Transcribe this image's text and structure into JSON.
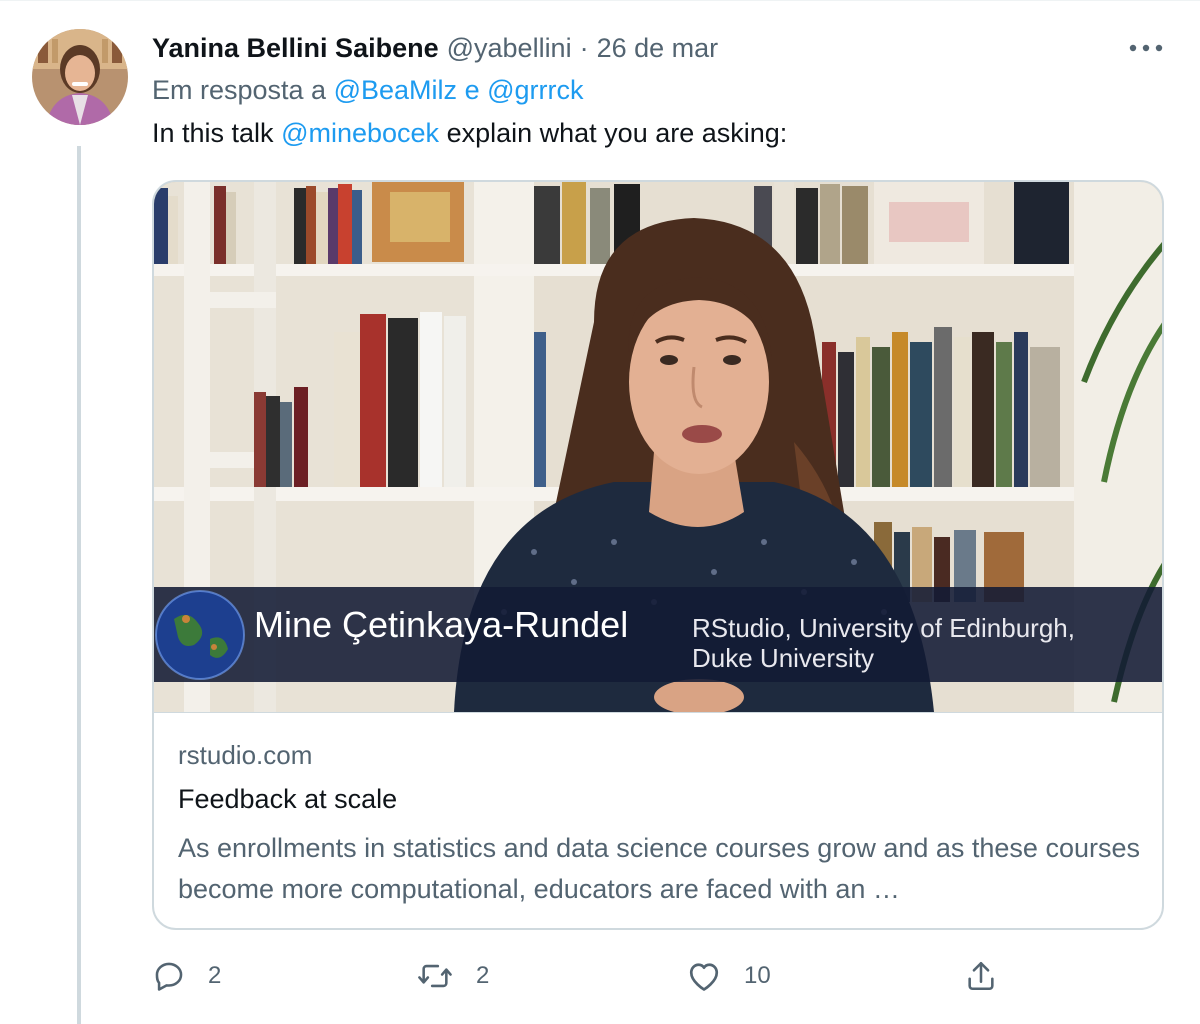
{
  "tweet": {
    "author_name": "Yanina Bellini Saibene",
    "handle": "@yabellini",
    "separator": "·",
    "date": "26 de mar",
    "reply_prefix": "Em resposta a",
    "reply_to": [
      "@BeaMilz",
      "@grrrck"
    ],
    "reply_joiner": "e",
    "text_before": "In this talk",
    "text_mention": "@minebocek",
    "text_after": "explain what you are asking:",
    "more_icon": "more-horizontal-icon"
  },
  "card": {
    "domain": "rstudio.com",
    "title": "Feedback at scale",
    "description": "As enrollments in statistics and data science courses grow and as these courses become more computational, educators are faced with an …",
    "video_overlay": {
      "name": "Mine Çetinkaya-Rundel",
      "affiliation_line1": "RStudio, University of Edinburgh,",
      "affiliation_line2": "Duke University"
    }
  },
  "actions": {
    "reply": {
      "icon": "reply-icon",
      "count": "2"
    },
    "retweet": {
      "icon": "retweet-icon",
      "count": "2"
    },
    "like": {
      "icon": "heart-icon",
      "count": "10"
    },
    "share": {
      "icon": "share-icon"
    }
  },
  "colors": {
    "link": "#1d9bf0",
    "secondary_text": "#536471",
    "primary_text": "#0f1419",
    "border": "#cfd9de"
  }
}
